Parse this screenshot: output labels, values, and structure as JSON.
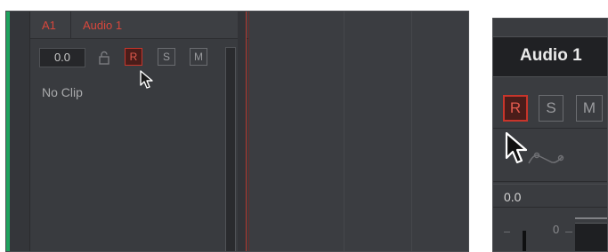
{
  "track_header": {
    "id": "A1",
    "name": "Audio 1",
    "volume": "0.0",
    "buttons": {
      "record": "R",
      "solo": "S",
      "mute": "M"
    },
    "clip_status": "No Clip"
  },
  "mixer_strip": {
    "name": "Audio 1",
    "buttons": {
      "record": "R",
      "solo": "S",
      "mute": "M"
    },
    "value": "0.0",
    "scale_zero": "0"
  },
  "icons": {
    "lock": "lock-icon",
    "cursor": "mouse-pointer-icon",
    "curve": "automation-curve-icon"
  },
  "colors": {
    "track_label": "#d8473c",
    "record_active": "#c8352b",
    "track_color": "#1fa25e",
    "panel_bg": "#393b3f"
  }
}
